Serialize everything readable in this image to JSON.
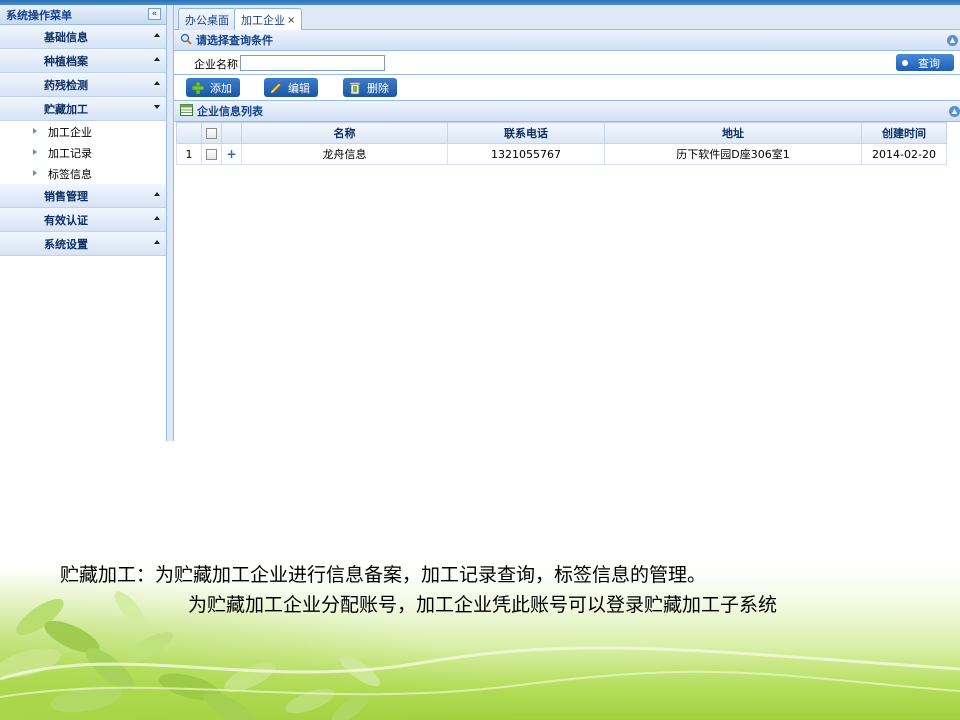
{
  "sidebar": {
    "title": "系统操作菜单",
    "collapse_symbol": "«",
    "groups_top": [
      {
        "label": "基础信息",
        "state": "collapsed"
      },
      {
        "label": "种植档案",
        "state": "collapsed"
      },
      {
        "label": "药残检测",
        "state": "collapsed"
      },
      {
        "label": "贮藏加工",
        "state": "expanded"
      }
    ],
    "sub_items": [
      "加工企业",
      "加工记录",
      "标签信息"
    ],
    "groups_bottom": [
      {
        "label": "销售管理",
        "state": "collapsed"
      },
      {
        "label": "有效认证",
        "state": "collapsed"
      },
      {
        "label": "系统设置",
        "state": "collapsed"
      }
    ]
  },
  "tabs": [
    {
      "label": "办公桌面",
      "active": false
    },
    {
      "label": "加工企业",
      "active": true,
      "close": "×"
    }
  ],
  "search_panel": {
    "title": "请选择查询条件",
    "field_label": "企业名称",
    "field_value": "",
    "query_button": "查询"
  },
  "toolbar": {
    "add": "添加",
    "edit": "编辑",
    "delete": "删除"
  },
  "list_panel": {
    "title": "企业信息列表",
    "columns": [
      "名称",
      "联系电话",
      "地址",
      "创建时间"
    ],
    "rows": [
      {
        "index": "1",
        "expand": "+",
        "name": "龙舟信息",
        "phone": "1321055767",
        "address": "历下软件园D座306室1",
        "created": "2014-02-20"
      }
    ]
  },
  "caption": {
    "line1": "贮藏加工：为贮藏加工企业进行信息备案，加工记录查询，标签信息的管理。",
    "line2": "为贮藏加工企业分配账号，加工企业凭此账号可以登录贮藏加工子系统"
  },
  "colors": {
    "accent": "#15428b",
    "panel_border": "#99bbe8",
    "button_blue": "#1d5fb4",
    "leaf_green": "#9fd03c"
  }
}
